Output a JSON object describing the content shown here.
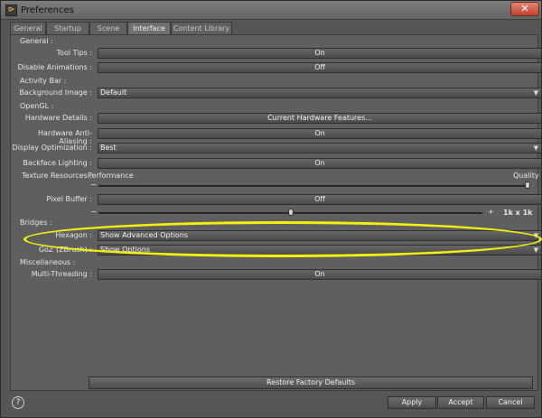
{
  "window": {
    "title": "Preferences",
    "close_icon": "✕",
    "app_icon": "⊳"
  },
  "tabs": [
    {
      "label": "General"
    },
    {
      "label": "Startup"
    },
    {
      "label": "Scene"
    },
    {
      "label": "Interface"
    },
    {
      "label": "Content Library"
    }
  ],
  "sections": {
    "general": "General :",
    "activity": "Activity Bar :",
    "opengl": "OpenGL :",
    "bridges": "Bridges :",
    "misc": "Miscellaneous :"
  },
  "rows": {
    "tooltips": {
      "label": "Tool Tips :",
      "value": "On"
    },
    "disable_anim": {
      "label": "Disable Animations :",
      "value": "Off"
    },
    "bg_image": {
      "label": "Background Image :",
      "value": "Default"
    },
    "hw_details": {
      "label": "Hardware Details :",
      "value": "Current Hardware Features..."
    },
    "hw_aa": {
      "label": "Hardware Anti-Aliasing :",
      "value": "On"
    },
    "display_opt": {
      "label": "Display Optimization :",
      "value": "Best"
    },
    "backface": {
      "label": "Backface Lighting :",
      "value": "On"
    },
    "texture": {
      "label": "Texture Resources :",
      "left": "Performance",
      "right": "Quality",
      "level": 0.995
    },
    "pixel_buffer": {
      "label": "Pixel Buffer :",
      "value": "Off",
      "level": 0.5,
      "size": "1k x 1k"
    },
    "hexagon": {
      "label": "Hexagon :",
      "value": "Show Advanced Options"
    },
    "goz": {
      "label": "GoZ (ZBrush) :",
      "value": "Show Options"
    },
    "multithreading": {
      "label": "Multi-Threading :",
      "value": "On"
    }
  },
  "buttons": {
    "restore": "Restore Factory Defaults",
    "apply": "Apply",
    "accept": "Accept",
    "cancel": "Cancel",
    "help": "?"
  },
  "colors": {
    "highlight": "#f3ef12"
  }
}
